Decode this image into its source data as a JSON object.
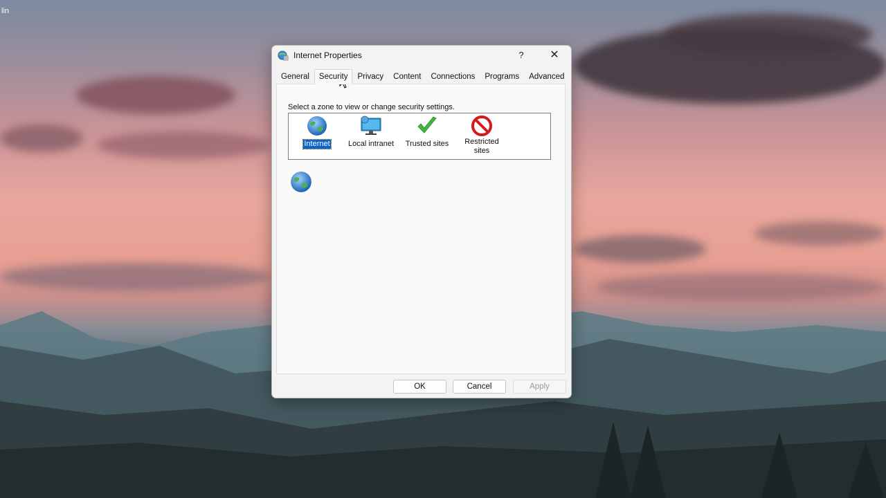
{
  "desktop": {
    "corner_label": "lin"
  },
  "dialog": {
    "title": "Internet Properties",
    "help_label": "?",
    "close_label": "✕",
    "tabs": [
      {
        "label": "General"
      },
      {
        "label": "Security",
        "active": true
      },
      {
        "label": "Privacy"
      },
      {
        "label": "Content"
      },
      {
        "label": "Connections"
      },
      {
        "label": "Programs"
      },
      {
        "label": "Advanced"
      }
    ],
    "security": {
      "instruction": "Select a zone to view or change security settings.",
      "zones": [
        {
          "label": "Internet",
          "icon": "globe-icon",
          "selected": true
        },
        {
          "label": "Local intranet",
          "icon": "intranet-icon"
        },
        {
          "label": "Trusted sites",
          "icon": "checkmark-icon"
        },
        {
          "label": "Restricted sites",
          "icon": "restricted-icon"
        }
      ],
      "selected_zone_icon": "globe-icon"
    },
    "buttons": {
      "ok": "OK",
      "cancel": "Cancel",
      "apply": "Apply"
    }
  },
  "colors": {
    "selection": "#0a64c8",
    "trusted_green": "#3cb83c",
    "restricted_red": "#d01c1c"
  }
}
